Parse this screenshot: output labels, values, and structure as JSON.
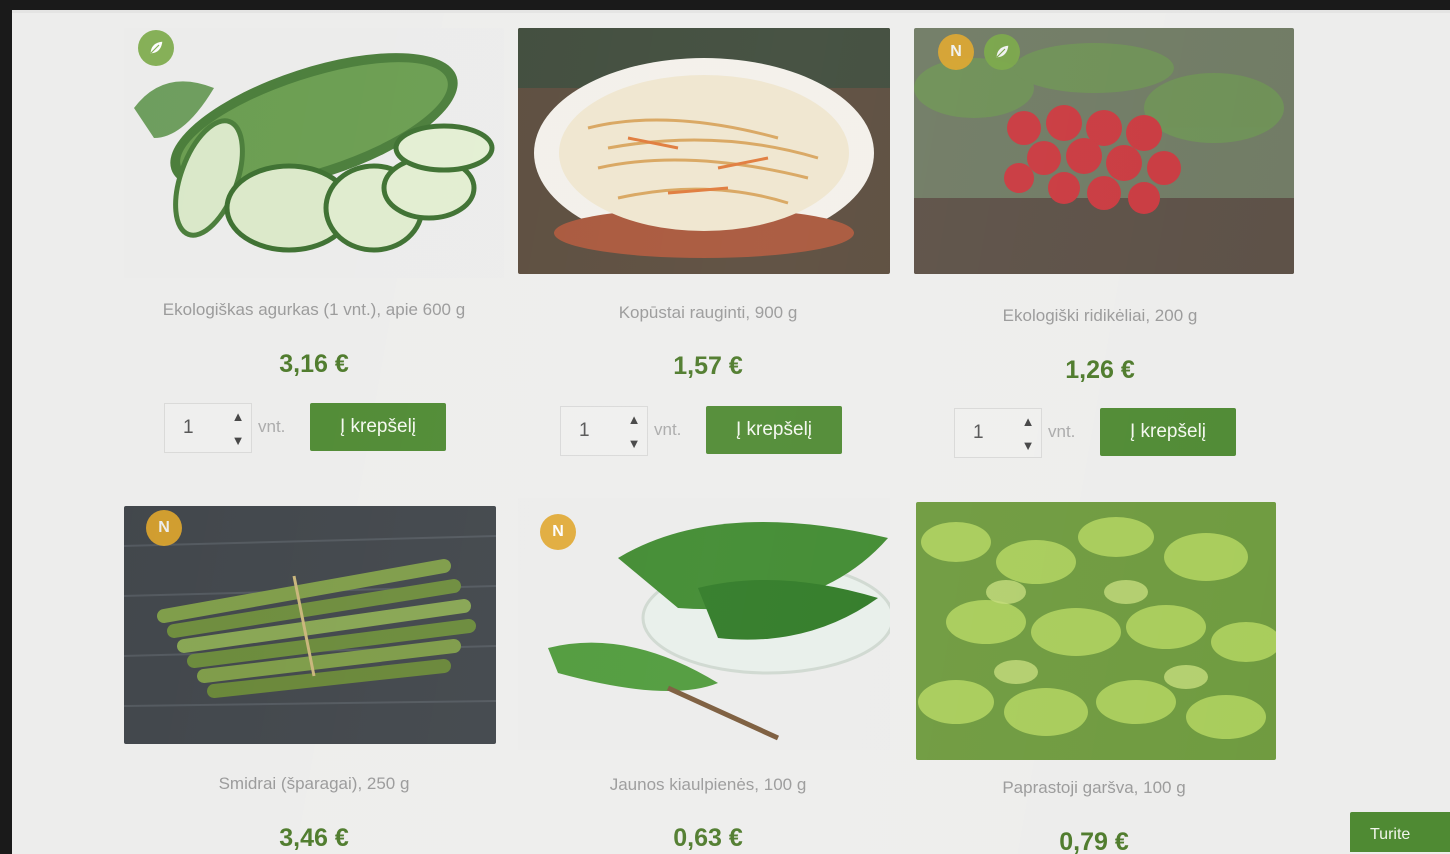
{
  "products": [
    {
      "name": "Ekologiškas agurkas (1 vnt.), apie 600 g",
      "price": "3,16 €",
      "qty": "1",
      "unit": "vnt.",
      "button": "Į krepšelį",
      "badges": [
        "eco-leaf-icon"
      ]
    },
    {
      "name": "Kopūstai rauginti, 900 g",
      "price": "1,57 €",
      "qty": "1",
      "unit": "vnt.",
      "button": "Į krepšelį",
      "badges": []
    },
    {
      "name": "Ekologiški ridikėliai, 200 g",
      "price": "1,26 €",
      "qty": "1",
      "unit": "vnt.",
      "button": "Į krepšelį",
      "badges": [
        "N",
        "eco-leaf-icon"
      ]
    },
    {
      "name": "Smidrai (šparagai), 250 g",
      "price": "3,46 €",
      "badges": [
        "N"
      ]
    },
    {
      "name": "Jaunos kiaulpienės, 100 g",
      "price": "0,63 €",
      "badges": [
        "N"
      ]
    },
    {
      "name": "Paprastoji garšva, 100 g",
      "price": "0,79 €",
      "badges": []
    }
  ],
  "badge_new_label": "N",
  "notice_button": "Turite",
  "colors": {
    "accent": "#4f8a33",
    "price": "#4d7a2a",
    "badge_new": "#e0a62a",
    "badge_eco": "#7aa946"
  }
}
